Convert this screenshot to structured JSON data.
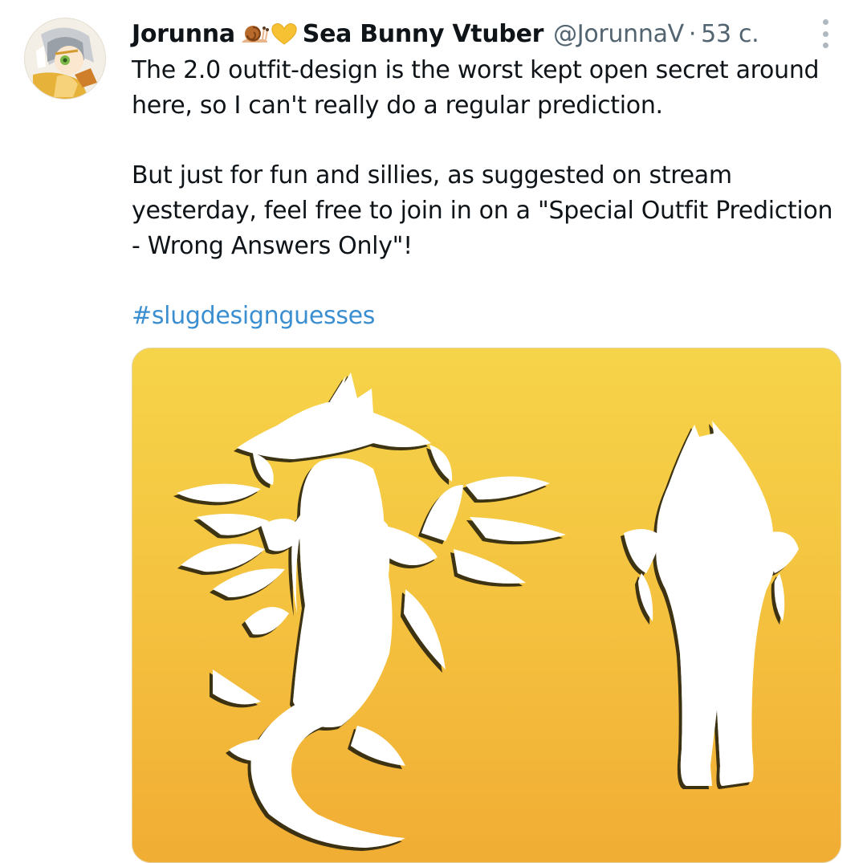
{
  "tweet": {
    "author_name": "Jorunna",
    "author_name_suffix": "Sea Bunny Vtuber",
    "handle": "@JorunnaV",
    "separator": "·",
    "time": "53 с.",
    "text_paragraphs": [
      "The 2.0 outfit-design is the worst kept open secret around here, so I can't really do a regular prediction.",
      "But just for fun and sillies, as suggested on stream yesterday, feel free to join in on a \"Special Outfit Prediction - Wrong Answers Only\"!"
    ],
    "hashtag": "#slugdesignguesses"
  },
  "icons": {
    "name_emojis": [
      "snail-emoji",
      "yellow-heart-emoji"
    ],
    "more": "more-options-icon"
  },
  "colors": {
    "text": "#0f1419",
    "secondary_text": "#536471",
    "hashtag": "#3b8fd0",
    "media_top": "#f6d449",
    "media_bottom": "#f1ad34"
  }
}
